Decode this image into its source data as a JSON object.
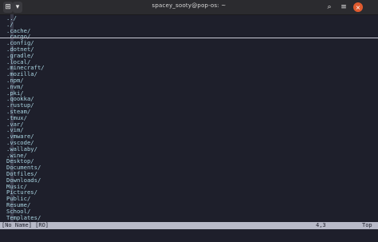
{
  "window": {
    "title": "spacey_sooty@pop-os: ~",
    "close_label": "×",
    "new_tab_label": "⊞",
    "menu_label": "▾",
    "search_label": "⌕",
    "hamburger_label": "≡"
  },
  "listing": [
    "../",
    "./",
    ".cache/",
    ".cargo/",
    ".config/",
    ".dotnet/",
    ".gradle/",
    ".local/",
    ".minecraft/",
    ".mozilla/",
    ".npm/",
    ".nvm/",
    ".pki/",
    ".qookka/",
    ".rustup/",
    ".steam/",
    ".tmux/",
    ".var/",
    ".vim/",
    ".vmware/",
    ".vscode/",
    ".wallaby/",
    ".wine/",
    "Desktop/",
    "Documents/",
    "Dotfiles/",
    "Downloads/",
    "Music/",
    "Pictures/",
    "Public/",
    "Resume/",
    "School/",
    "Templates/"
  ],
  "status": {
    "left": "[No Name] [RO]",
    "position": "4,3",
    "percent": "Top"
  },
  "colors": {
    "background": "#1e1f2b",
    "text": "#a8d3e0",
    "statusbar": "#b8bac8",
    "close": "#e05b2f"
  }
}
